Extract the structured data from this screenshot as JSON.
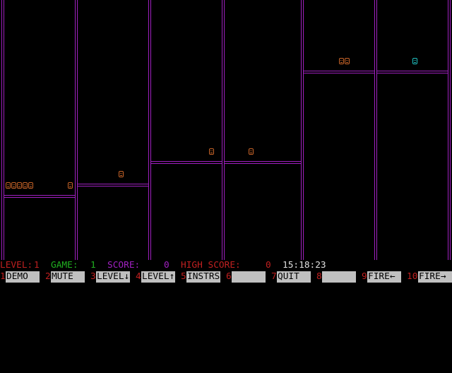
{
  "colors": {
    "wall": "#a020c0",
    "sprite_orange": "#c86428",
    "sprite_cyan": "#20c0c0",
    "label_red": "#c02020",
    "label_green": "#20b020",
    "label_purple": "#a020c0",
    "value_white": "#e0e0e0",
    "fkey_num": "#c02020",
    "fkey_bg": "#c0c0c0"
  },
  "game": {
    "sprites": [
      {
        "color": "orange"
      },
      {
        "color": "orange"
      },
      {
        "color": "orange"
      },
      {
        "color": "orange"
      },
      {
        "color": "orange"
      },
      {
        "color": "orange"
      },
      {
        "color": "orange"
      },
      {
        "color": "orange"
      },
      {
        "color": "orange"
      },
      {
        "color": "orange"
      },
      {
        "color": "orange"
      },
      {
        "color": "cyan"
      }
    ]
  },
  "status": {
    "level_label": "LEVEL:",
    "level_value": "1",
    "game_label": "GAME:",
    "game_value": "1",
    "score_label": "SCORE:",
    "score_value": "0",
    "high_score_label": "HIGH SCORE:",
    "high_score_value": "0",
    "clock": "15:18:23"
  },
  "fkeys": [
    {
      "num": "1",
      "label": "DEMO"
    },
    {
      "num": "2",
      "label": "MUTE"
    },
    {
      "num": "3",
      "label": "LEVEL↓"
    },
    {
      "num": "4",
      "label": "LEVEL↑"
    },
    {
      "num": "5",
      "label": "INSTRS"
    },
    {
      "num": "6",
      "label": ""
    },
    {
      "num": "7",
      "label": "QUIT"
    },
    {
      "num": "8",
      "label": ""
    },
    {
      "num": "9",
      "label": "FIRE←"
    },
    {
      "num": "10",
      "label": "FIRE→"
    }
  ]
}
